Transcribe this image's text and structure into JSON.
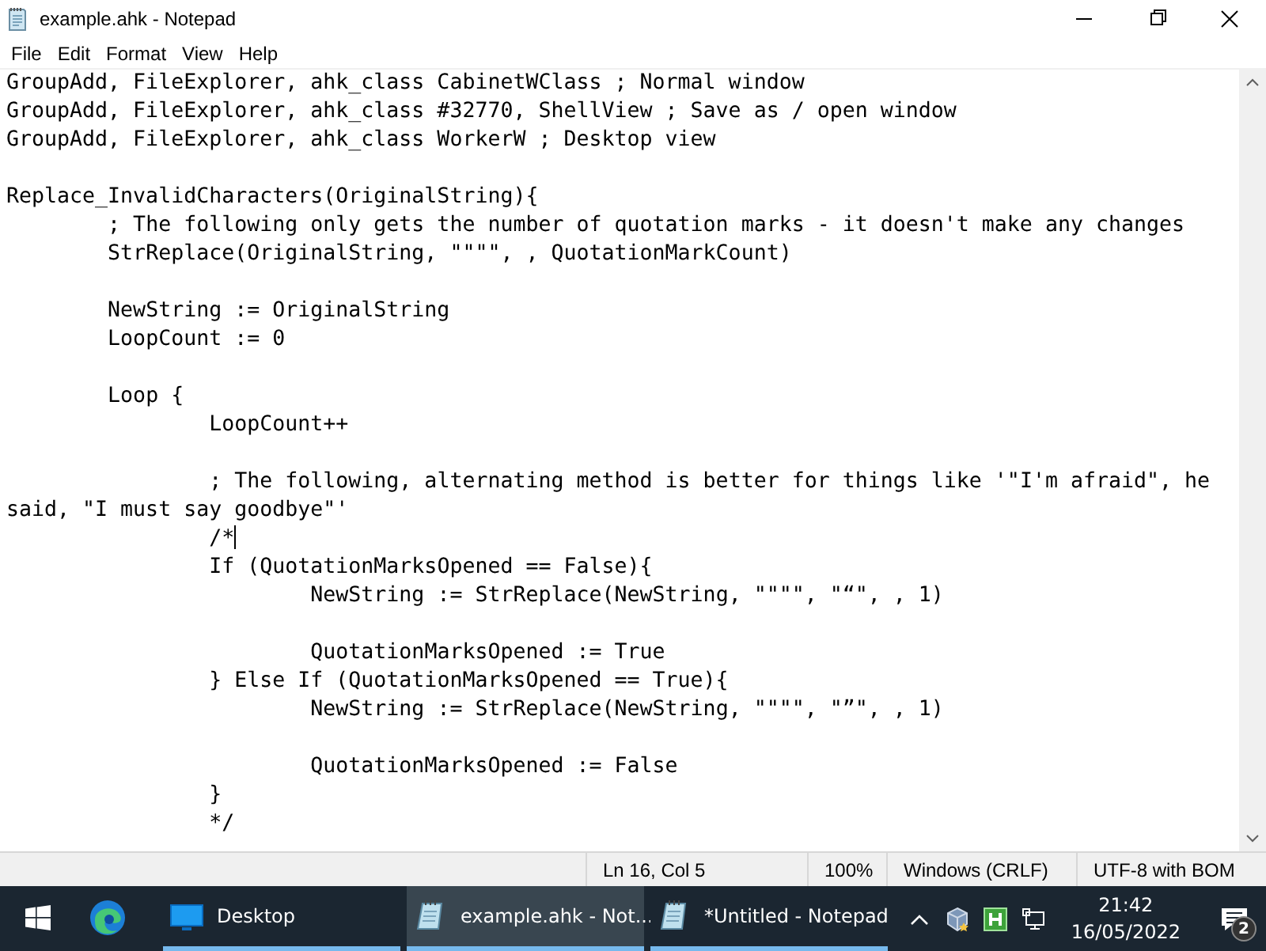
{
  "window": {
    "title": "example.ahk - Notepad"
  },
  "menu": [
    "File",
    "Edit",
    "Format",
    "View",
    "Help"
  ],
  "editor": {
    "lines": [
      {
        "kind": "code",
        "text": "GroupAdd, FileExplorer, ahk_class CabinetWClass ; Normal window",
        "caret": false
      },
      {
        "kind": "code",
        "text": "GroupAdd, FileExplorer, ahk_class #32770, ShellView ; Save as / open window",
        "caret": false
      },
      {
        "kind": "code",
        "text": "GroupAdd, FileExplorer, ahk_class WorkerW ; Desktop view",
        "caret": false
      },
      {
        "kind": "blank"
      },
      {
        "kind": "code",
        "text": "Replace_InvalidCharacters(OriginalString){",
        "caret": false
      },
      {
        "kind": "code",
        "text": "\t; The following only gets the number of quotation marks - it doesn't make any changes",
        "caret": false
      },
      {
        "kind": "code",
        "text": "\tStrReplace(OriginalString, \"\"\"\", , QuotationMarkCount)",
        "caret": false
      },
      {
        "kind": "blank"
      },
      {
        "kind": "code",
        "text": "\tNewString := OriginalString",
        "caret": false
      },
      {
        "kind": "code",
        "text": "\tLoopCount := 0",
        "caret": false
      },
      {
        "kind": "blank"
      },
      {
        "kind": "code",
        "text": "\tLoop {",
        "caret": false
      },
      {
        "kind": "code",
        "text": "\t\tLoopCount++",
        "caret": false
      },
      {
        "kind": "blank"
      },
      {
        "kind": "code",
        "text": "\t\t; The following, alternating method is better for things like '\"I'm afraid\", he said, \"I must say goodbye\"'",
        "caret": false
      },
      {
        "kind": "code",
        "text": "\t\t/*",
        "caret": true
      },
      {
        "kind": "code",
        "text": "\t\tIf (QuotationMarksOpened == False){",
        "caret": false
      },
      {
        "kind": "code",
        "text": "\t\t\tNewString := StrReplace(NewString, \"\"\"\", \"“\", , 1)",
        "caret": false
      },
      {
        "kind": "blank"
      },
      {
        "kind": "code",
        "text": "\t\t\tQuotationMarksOpened := True",
        "caret": false
      },
      {
        "kind": "code",
        "text": "\t\t} Else If (QuotationMarksOpened == True){",
        "caret": false
      },
      {
        "kind": "code",
        "text": "\t\t\tNewString := StrReplace(NewString, \"\"\"\", \"”\", , 1)",
        "caret": false
      },
      {
        "kind": "blank"
      },
      {
        "kind": "code",
        "text": "\t\t\tQuotationMarksOpened := False",
        "caret": false
      },
      {
        "kind": "code",
        "text": "\t\t}",
        "caret": false
      },
      {
        "kind": "code",
        "text": "\t\t*/",
        "caret": false
      }
    ]
  },
  "status_bar": {
    "position": "Ln 16, Col 5",
    "zoom": "100%",
    "line_endings": "Windows (CRLF)",
    "encoding": "UTF-8 with BOM"
  },
  "taskbar": {
    "items": [
      {
        "kind": "desktop",
        "label": "Desktop",
        "selected": false
      },
      {
        "kind": "notepad",
        "label": "example.ahk - Not...",
        "selected": true
      },
      {
        "kind": "notepad",
        "label": "*Untitled - Notepad",
        "selected": false
      }
    ],
    "time": "21:42",
    "date": "16/05/2022",
    "notification_count": "2"
  }
}
